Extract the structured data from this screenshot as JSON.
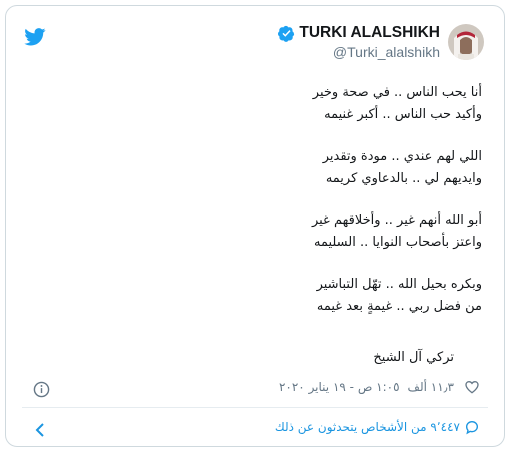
{
  "tweet": {
    "author": {
      "display_name": "TURKI ALALSHIKH",
      "handle": "@Turki_alalshikh"
    },
    "lines": [
      "أنا يحب الناس .. في صحة وخير",
      "وأكيد حب الناس .. أكبر غنيمه",
      "",
      "اللي لهم عندي .. مودة وتقدير",
      "وايديهم لي .. بالدعاوي كريمه",
      "",
      "أبو الله أنهم غير .. وأخلاقهم غير",
      "واعتز بأصحاب النوايا .. السليمه",
      "",
      "وبكره بحيل الله .. تهّل التباشير",
      "من فضل ربي .. غيمةٍ بعد غيمه"
    ],
    "signature": "تركي آل الشيخ",
    "likes_count": "١١٫٣ ألف",
    "timestamp": "١:٠٥ ص - ١٩ يناير ٢٠٢٠",
    "people_talking": "٩٬٤٤٧ من الأشخاص يتحدثون عن ذلك"
  },
  "icons": {
    "brand": "twitter-bird-icon",
    "verified": "verified-badge-icon",
    "info": "info-icon",
    "like": "heart-icon",
    "reply": "speech-bubble-icon",
    "expand": "chevron-left-icon"
  },
  "colors": {
    "twitter_blue": "#1da1f2",
    "text": "#14171a",
    "muted": "#657786",
    "link": "#1b95e0"
  }
}
